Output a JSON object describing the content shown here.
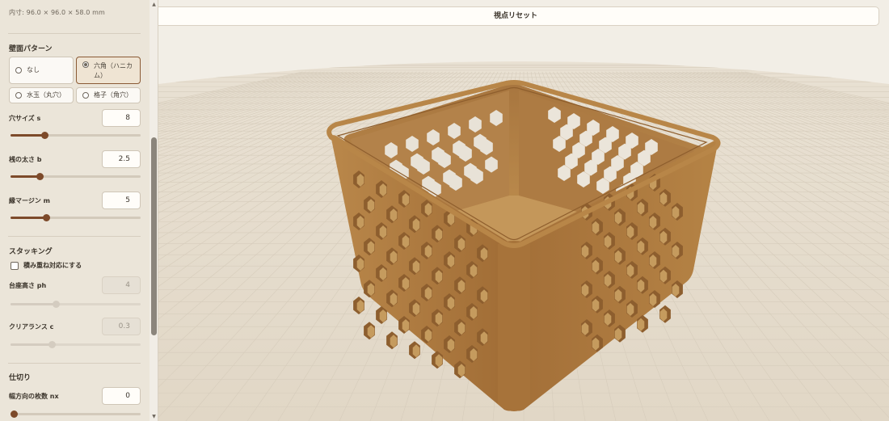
{
  "sidebar": {
    "dimensions": "内寸: 96.0 × 96.0 × 58.0 mm",
    "wall_pattern": {
      "title": "壁面パターン",
      "options": [
        {
          "label": "なし",
          "selected": false
        },
        {
          "label": "六角（ハニカム）",
          "selected": true
        },
        {
          "label": "水玉（丸穴）",
          "selected": false
        },
        {
          "label": "格子（角穴）",
          "selected": false
        }
      ]
    },
    "hole_size": {
      "label": "穴サイズ s",
      "value": "8",
      "fraction": 0.25
    },
    "bar_width": {
      "label": "桟の太さ b",
      "value": "2.5",
      "fraction": 0.21
    },
    "edge_margin": {
      "label": "縁マージン m",
      "value": "5",
      "fraction": 0.26
    },
    "stacking": {
      "title": "スタッキング",
      "checkbox_label": "積み重ね対応にする",
      "checked": false,
      "base_height": {
        "label": "台座高さ ph",
        "value": "4",
        "fraction": 0.34
      },
      "clearance": {
        "label": "クリアランス c",
        "value": "0.3",
        "fraction": 0.31
      }
    },
    "divider": {
      "title": "仕切り",
      "width_count": {
        "label": "幅方向の枚数 nx",
        "value": "0",
        "fraction": 0.0
      }
    }
  },
  "viewport": {
    "reset_label": "視点リセット",
    "colors": {
      "background": "#f2eee6",
      "floor": "#e5dccd",
      "grid": "#d3c9b8",
      "box_light": "#b98848",
      "box_mid": "#a7733a",
      "box_dark": "#8a5c2c"
    }
  }
}
